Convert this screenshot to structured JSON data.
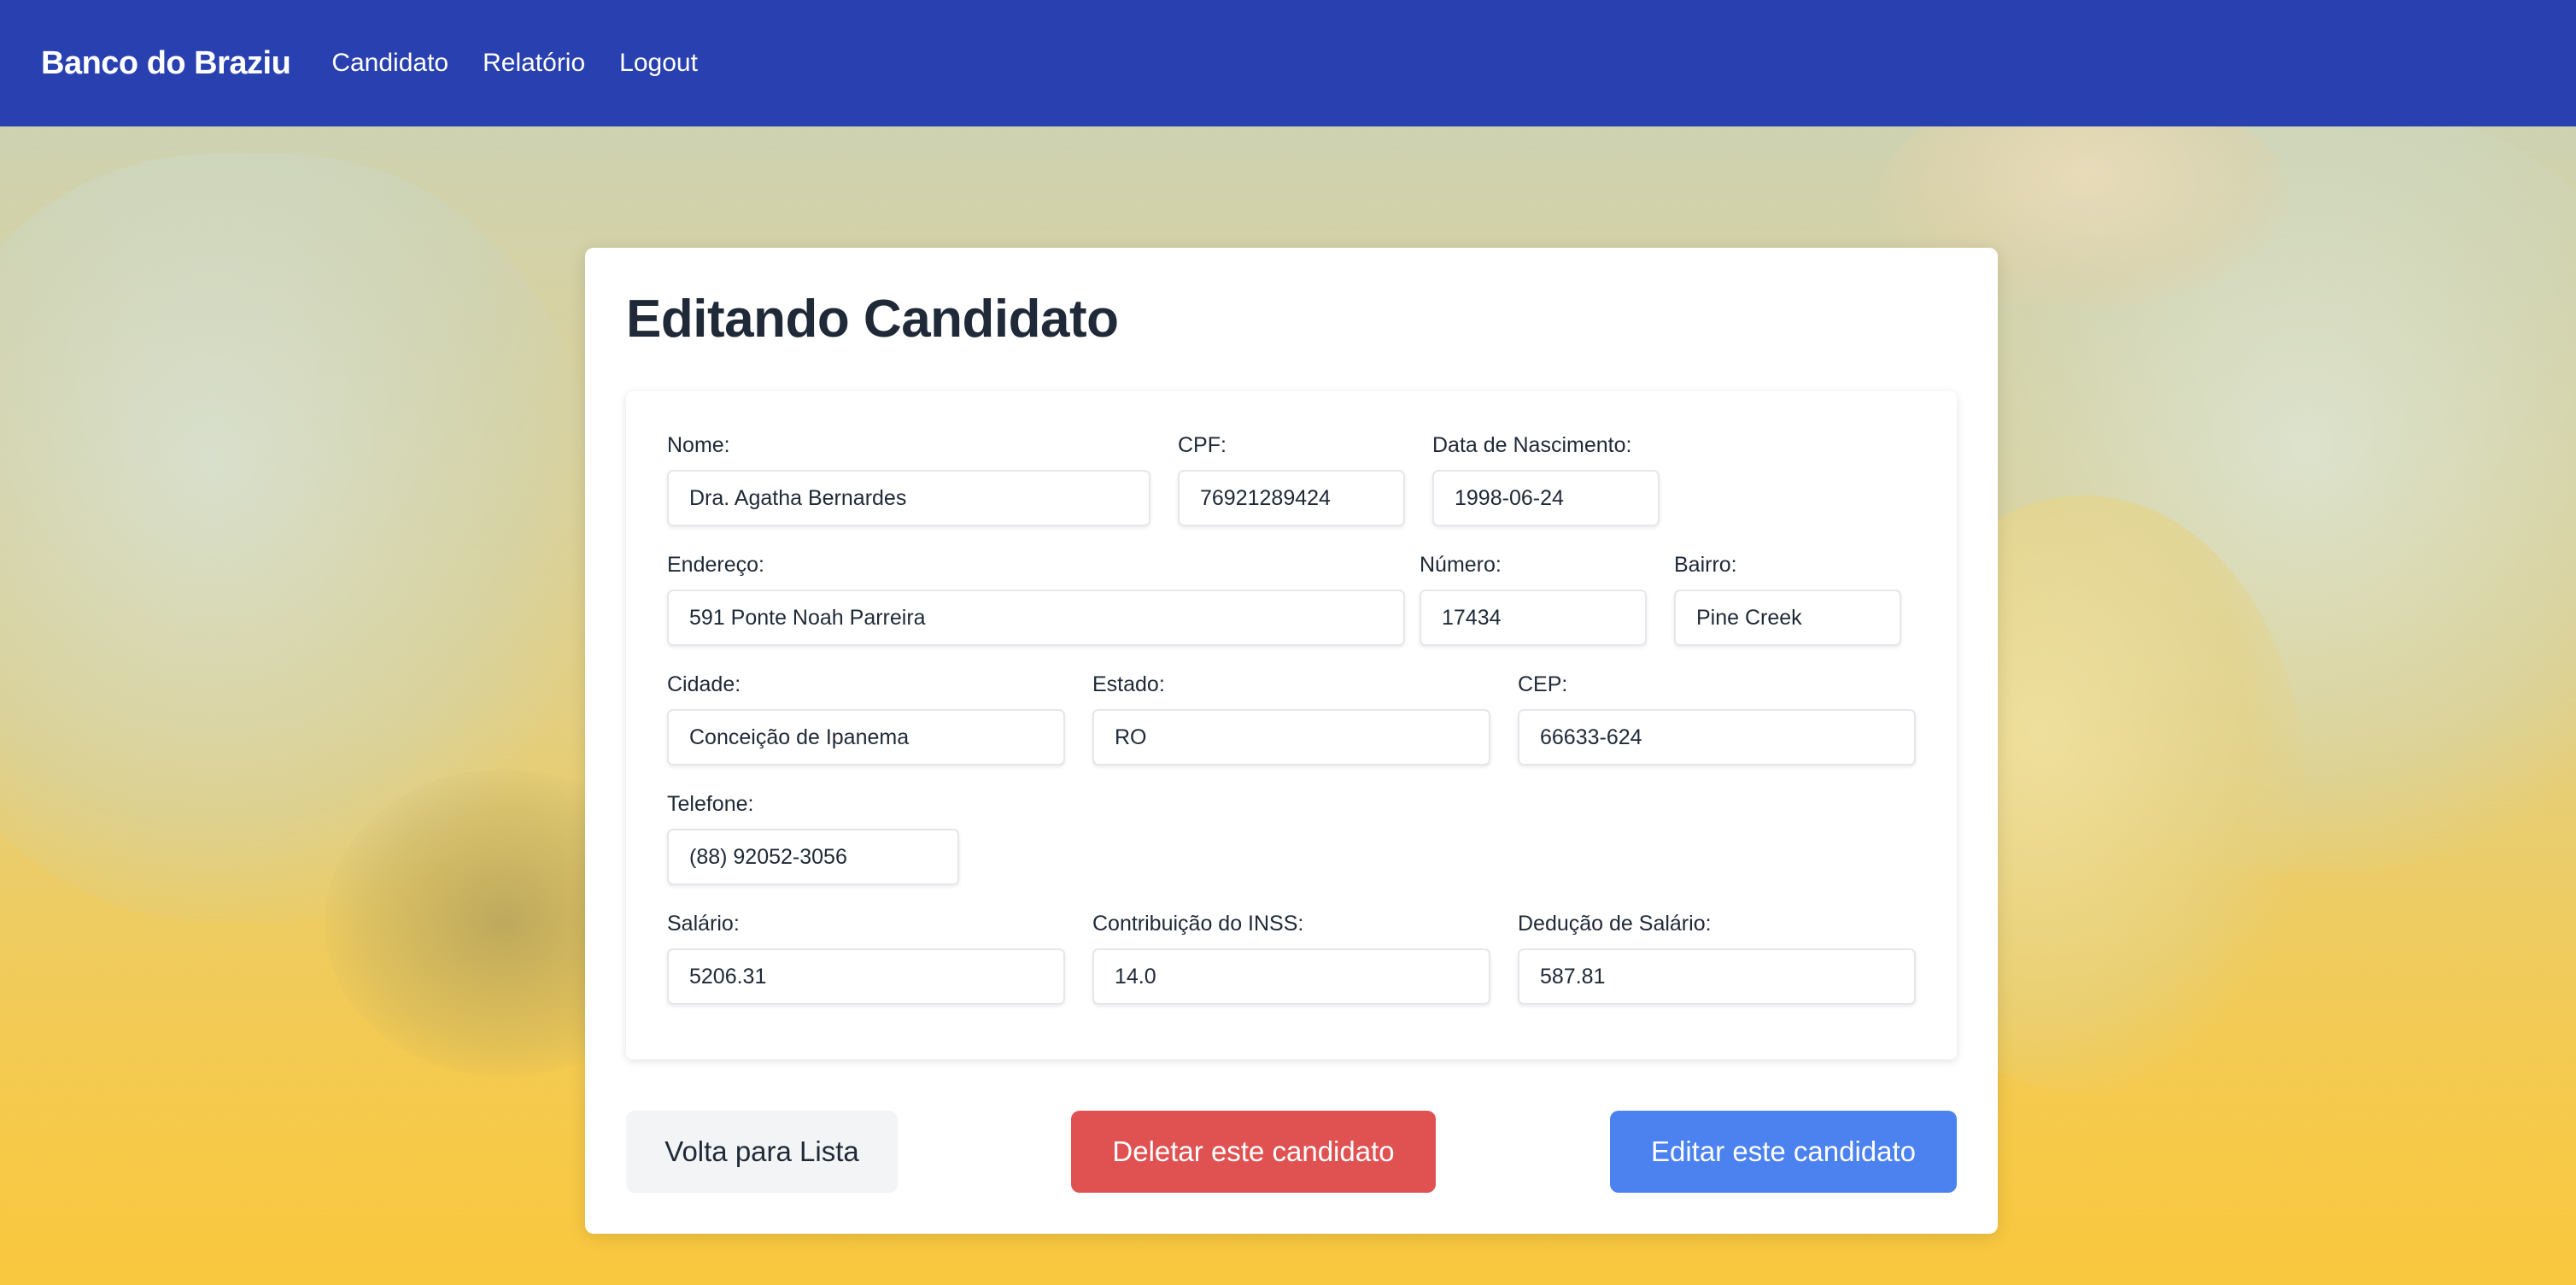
{
  "navbar": {
    "brand": "Banco do Braziu",
    "links": [
      "Candidato",
      "Relatório",
      "Logout"
    ]
  },
  "page": {
    "title": "Editando Candidato"
  },
  "form": {
    "nome": {
      "label": "Nome:",
      "value": "Dra. Agatha Bernardes"
    },
    "cpf": {
      "label": "CPF:",
      "value": "76921289424"
    },
    "data_nascimento": {
      "label": "Data de Nascimento:",
      "value": "1998-06-24"
    },
    "endereco": {
      "label": "Endereço:",
      "value": "591 Ponte Noah Parreira"
    },
    "numero": {
      "label": "Número:",
      "value": "17434"
    },
    "bairro": {
      "label": "Bairro:",
      "value": "Pine Creek"
    },
    "cidade": {
      "label": "Cidade:",
      "value": "Conceição de Ipanema"
    },
    "estado": {
      "label": "Estado:",
      "value": "RO"
    },
    "cep": {
      "label": "CEP:",
      "value": "66633-624"
    },
    "telefone": {
      "label": "Telefone:",
      "value": "(88) 92052-3056"
    },
    "salario": {
      "label": "Salário:",
      "value": "5206.31"
    },
    "inss": {
      "label": "Contribuição do INSS:",
      "value": "14.0"
    },
    "deducao": {
      "label": "Dedução de Salário:",
      "value": "587.81"
    }
  },
  "actions": {
    "back_label": "Volta para Lista",
    "delete_label": "Deletar este candidato",
    "edit_label": "Editar este candidato"
  },
  "colors": {
    "navbar": "#2840b0",
    "delete": "#e05252",
    "edit": "#4b82ef",
    "back": "#f3f4f6"
  }
}
